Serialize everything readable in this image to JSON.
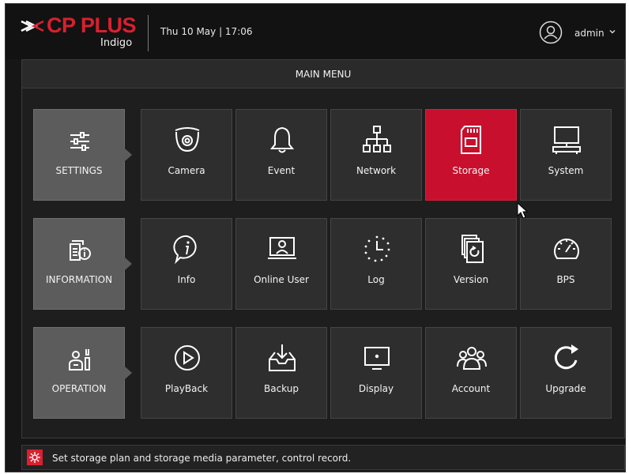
{
  "header": {
    "brand": "CP PLUS",
    "brand_sub": "Indigo",
    "datetime": "Thu 10 May | 17:06",
    "user": "admin",
    "icons": {
      "user": "user-circle-icon",
      "dropdown": "chevron-down-icon"
    }
  },
  "main": {
    "title": "MAIN MENU",
    "categories": [
      {
        "label": "SETTINGS",
        "icon": "sliders-icon"
      },
      {
        "label": "INFORMATION",
        "icon": "info-docs-icon"
      },
      {
        "label": "OPERATION",
        "icon": "maintenance-icon"
      }
    ],
    "rows": [
      [
        {
          "label": "Camera",
          "icon": "dome-camera-icon"
        },
        {
          "label": "Event",
          "icon": "bell-icon"
        },
        {
          "label": "Network",
          "icon": "network-icon"
        },
        {
          "label": "Storage",
          "icon": "sd-card-icon",
          "active": true
        },
        {
          "label": "System",
          "icon": "monitor-icon"
        }
      ],
      [
        {
          "label": "Info",
          "icon": "info-icon"
        },
        {
          "label": "Online User",
          "icon": "online-user-icon"
        },
        {
          "label": "Log",
          "icon": "log-clock-icon"
        },
        {
          "label": "Version",
          "icon": "version-icon"
        },
        {
          "label": "BPS",
          "icon": "gauge-icon"
        }
      ],
      [
        {
          "label": "PlayBack",
          "icon": "play-icon"
        },
        {
          "label": "Backup",
          "icon": "backup-icon"
        },
        {
          "label": "Display",
          "icon": "display-icon"
        },
        {
          "label": "Account",
          "icon": "account-group-icon"
        },
        {
          "label": "Upgrade",
          "icon": "upgrade-icon"
        }
      ]
    ]
  },
  "status": {
    "text": "Set storage plan and storage media parameter, control record.",
    "icon": "storage-settings-icon"
  },
  "colors": {
    "accent": "#c8102e",
    "brand": "#d8202f",
    "background": "#161616",
    "tile": "#2e2e2e",
    "category": "#5c5c5c"
  }
}
